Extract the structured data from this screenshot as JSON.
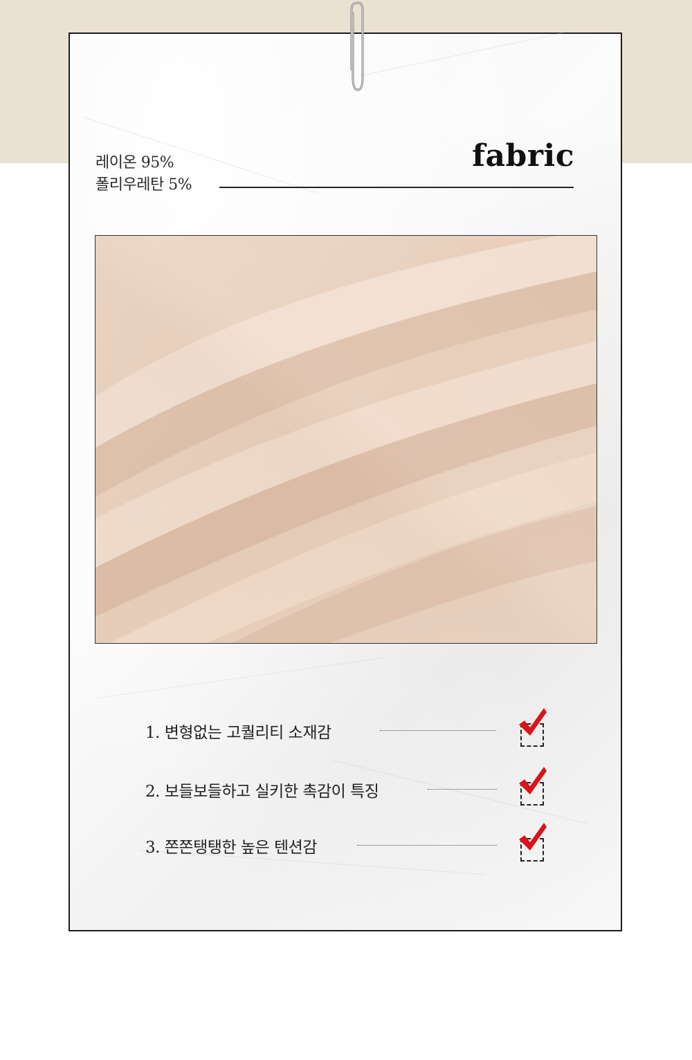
{
  "composition": {
    "line1": "레이온 95%",
    "line2": "폴리우레탄 5%"
  },
  "title": "fabric",
  "features": [
    {
      "text": "1. 변형없는 고퀄리티 소재감",
      "checked": true
    },
    {
      "text": "2. 보들보들하고 실키한 촉감이 특징",
      "checked": true
    },
    {
      "text": "3. 쫀쫀탱탱한 높은 텐션감",
      "checked": true
    }
  ],
  "icons": {
    "clip": "paperclip-icon",
    "check": "red-check-icon"
  },
  "colors": {
    "band": "#ebe1d3",
    "fabric": "#e8d2c1",
    "check": "#d9141b",
    "ink": "#222222"
  }
}
